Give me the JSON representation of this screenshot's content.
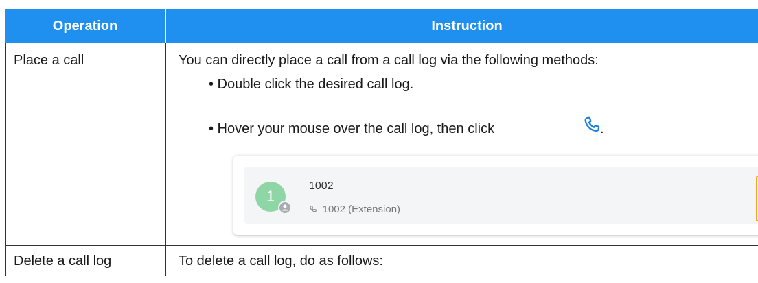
{
  "table": {
    "header": {
      "operation": "Operation",
      "instruction": "Instruction"
    },
    "rows": [
      {
        "operation": "Place a call",
        "instruction_intro": "You can directly place a call from a call log via the following methods:",
        "bullets": [
          "• Double click the desired call log.",
          "• Hover your mouse over the call log, then click",
          "."
        ],
        "icon": "phone-icon",
        "call_log_card": {
          "avatar_initial": "1",
          "name": "1002",
          "subtitle": "1002 (Extension)",
          "sub_icon": "phone-incoming-icon",
          "badge_icon": "contact-icon"
        }
      },
      {
        "operation": "Delete a call log",
        "instruction_intro": "To delete a call log, do as follows:"
      }
    ]
  },
  "colors": {
    "header_bg": "#1f8ff0",
    "accent_orange": "#f5a623",
    "avatar_green": "#8fd6a7"
  }
}
